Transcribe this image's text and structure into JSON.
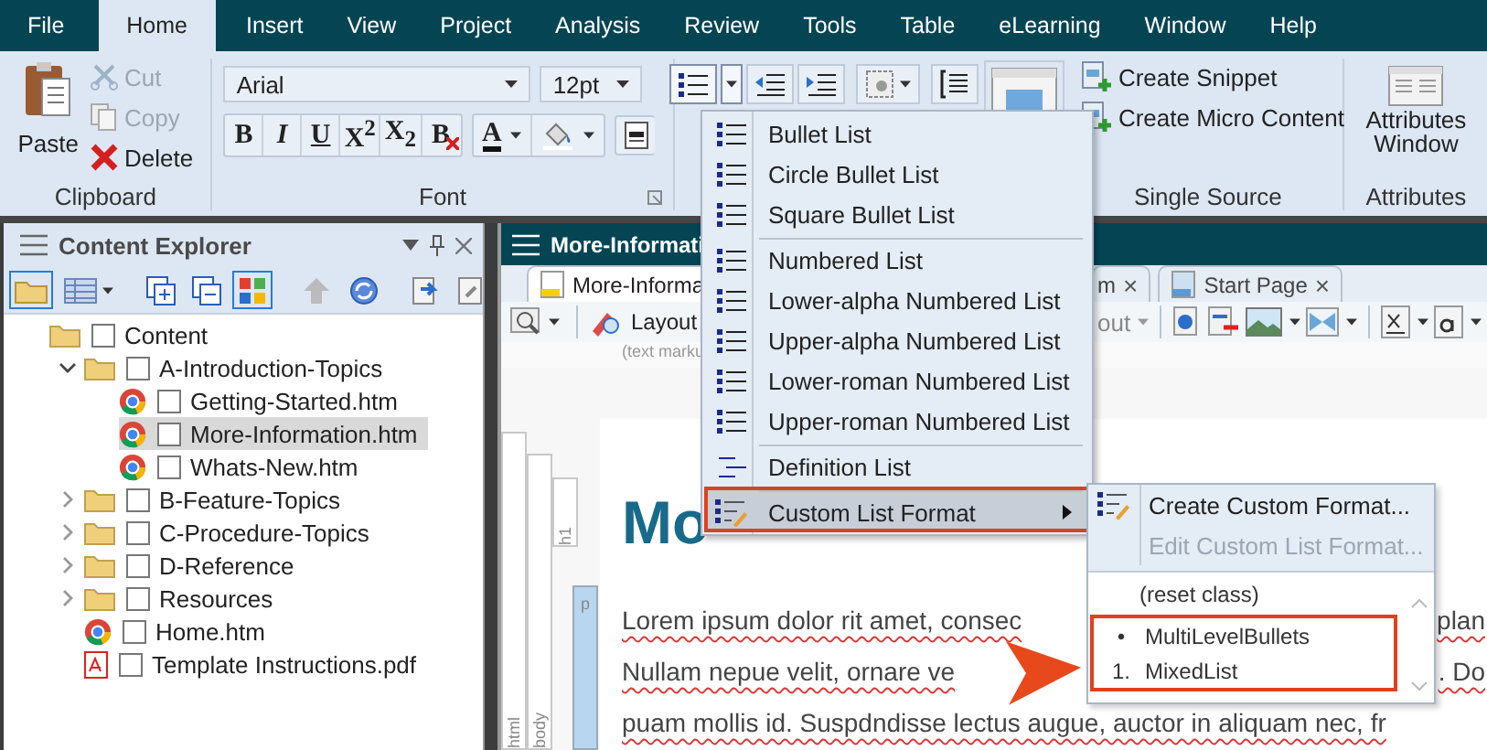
{
  "menu_bar": {
    "tabs": [
      {
        "label": "File",
        "selected": false
      },
      {
        "label": "Home",
        "selected": true
      },
      {
        "label": "Insert",
        "selected": false
      },
      {
        "label": "View",
        "selected": false
      },
      {
        "label": "Project",
        "selected": false
      },
      {
        "label": "Analysis",
        "selected": false
      },
      {
        "label": "Review",
        "selected": false
      },
      {
        "label": "Tools",
        "selected": false
      },
      {
        "label": "Table",
        "selected": false
      },
      {
        "label": "eLearning",
        "selected": false
      },
      {
        "label": "Window",
        "selected": false
      },
      {
        "label": "Help",
        "selected": false
      }
    ]
  },
  "ribbon": {
    "clipboard": {
      "label": "Clipboard",
      "paste": "Paste",
      "actions": [
        {
          "label": "Cut",
          "kind": "cut",
          "disabled": true
        },
        {
          "label": "Copy",
          "kind": "copy",
          "disabled": true
        },
        {
          "label": "Delete",
          "kind": "delete",
          "disabled": false
        }
      ]
    },
    "font": {
      "label": "Font",
      "family": "Arial",
      "size": "12pt",
      "styles": [
        {
          "text": "B",
          "kind": "bold"
        },
        {
          "text": "I",
          "kind": "italic"
        },
        {
          "text": "U",
          "kind": "underline"
        },
        {
          "text": "X$^{2}$",
          "kind": "plain"
        },
        {
          "text": "X$_{2}$",
          "kind": "plain"
        },
        {
          "text": "B",
          "kind": "clear"
        }
      ],
      "color_button": "A"
    },
    "single_source": {
      "label": "Single Source",
      "actions": [
        "Create Snippet",
        "Create Micro Content"
      ]
    },
    "attributes": {
      "label": "Attributes",
      "button": "Attributes Window"
    }
  },
  "content_explorer": {
    "title": "Content Explorer",
    "tree": [
      {
        "label": "Content",
        "kind": "folder",
        "checked": false,
        "selected": false,
        "children": [
          {
            "label": "A-Introduction-Topics",
            "kind": "folder",
            "checked": false,
            "selected": false,
            "expanded": true,
            "children": [
              {
                "label": "Getting-Started.htm",
                "kind": "page",
                "checked": false,
                "selected": false
              },
              {
                "label": "More-Information.htm",
                "kind": "page",
                "checked": false,
                "selected": true
              },
              {
                "label": "Whats-New.htm",
                "kind": "page",
                "checked": false,
                "selected": false
              }
            ]
          },
          {
            "label": "B-Feature-Topics",
            "kind": "folder",
            "checked": false,
            "selected": false,
            "expanded": false
          },
          {
            "label": "C-Procedure-Topics",
            "kind": "folder",
            "checked": false,
            "selected": false,
            "expanded": false
          },
          {
            "label": "D-Reference",
            "kind": "folder",
            "checked": false,
            "selected": false,
            "expanded": false
          },
          {
            "label": "Resources",
            "kind": "folder",
            "checked": false,
            "selected": false,
            "expanded": false
          },
          {
            "label": "Home.htm",
            "kind": "page",
            "checked": false,
            "selected": false
          },
          {
            "label": "Template Instructions.pdf",
            "kind": "pdf",
            "checked": false,
            "selected": false
          }
        ]
      }
    ]
  },
  "editor": {
    "title": "More-Informati",
    "tabs": [
      {
        "label": "More-Informa",
        "selected": true
      },
      {
        "label": "m",
        "close": "×",
        "selected": false
      },
      {
        "label": "Start Page",
        "close": "×",
        "selected": false
      }
    ],
    "toolbar_label": "Layout",
    "toolbar_label_right": "out",
    "markup_hint": "(text marku",
    "structure_tags": [
      "html",
      "body",
      "h1",
      "p"
    ],
    "heading": "Mo",
    "paragraph_lines": [
      {
        "text": "Lorem ipsum dolor rit amet, consec",
        "end": "plan"
      },
      {
        "text": "Nullam nepue velit, ornare ve",
        "end": ". Do"
      },
      {
        "text": "puam mollis id. Suspdndisse lectus augue, auctor in aliquam nec, fr"
      }
    ]
  },
  "list_menu": {
    "items": [
      {
        "label": "Bullet List",
        "kind": "item",
        "separated": false,
        "selected": false
      },
      {
        "label": "Circle Bullet List",
        "kind": "item",
        "separated": false,
        "selected": false
      },
      {
        "label": "Square Bullet List",
        "kind": "item",
        "separated": false,
        "selected": false
      },
      {
        "label": "Numbered List",
        "kind": "item",
        "separated": true,
        "selected": false
      },
      {
        "label": "Lower-alpha Numbered List",
        "kind": "item",
        "separated": false,
        "selected": false
      },
      {
        "label": "Upper-alpha Numbered List",
        "kind": "item",
        "separated": false,
        "selected": false
      },
      {
        "label": "Lower-roman Numbered List",
        "kind": "item",
        "separated": false,
        "selected": false
      },
      {
        "label": "Upper-roman Numbered List",
        "kind": "item",
        "separated": false,
        "selected": false
      },
      {
        "label": "Definition List",
        "kind": "definition",
        "separated": true,
        "selected": false
      },
      {
        "label": "Custom List Format",
        "kind": "submenu",
        "separated": true,
        "selected": true
      }
    ]
  },
  "custom_submenu": {
    "actions": [
      {
        "label": "Create Custom Format...",
        "disabled": false
      },
      {
        "label": "Edit Custom List Format...",
        "disabled": true
      }
    ],
    "classes": [
      {
        "label": "(reset class)",
        "highlighted": false
      },
      {
        "marker": "•",
        "label": "MultiLevelBullets",
        "highlighted": true
      },
      {
        "marker": "1.",
        "label": "MixedList",
        "highlighted": true
      }
    ]
  }
}
